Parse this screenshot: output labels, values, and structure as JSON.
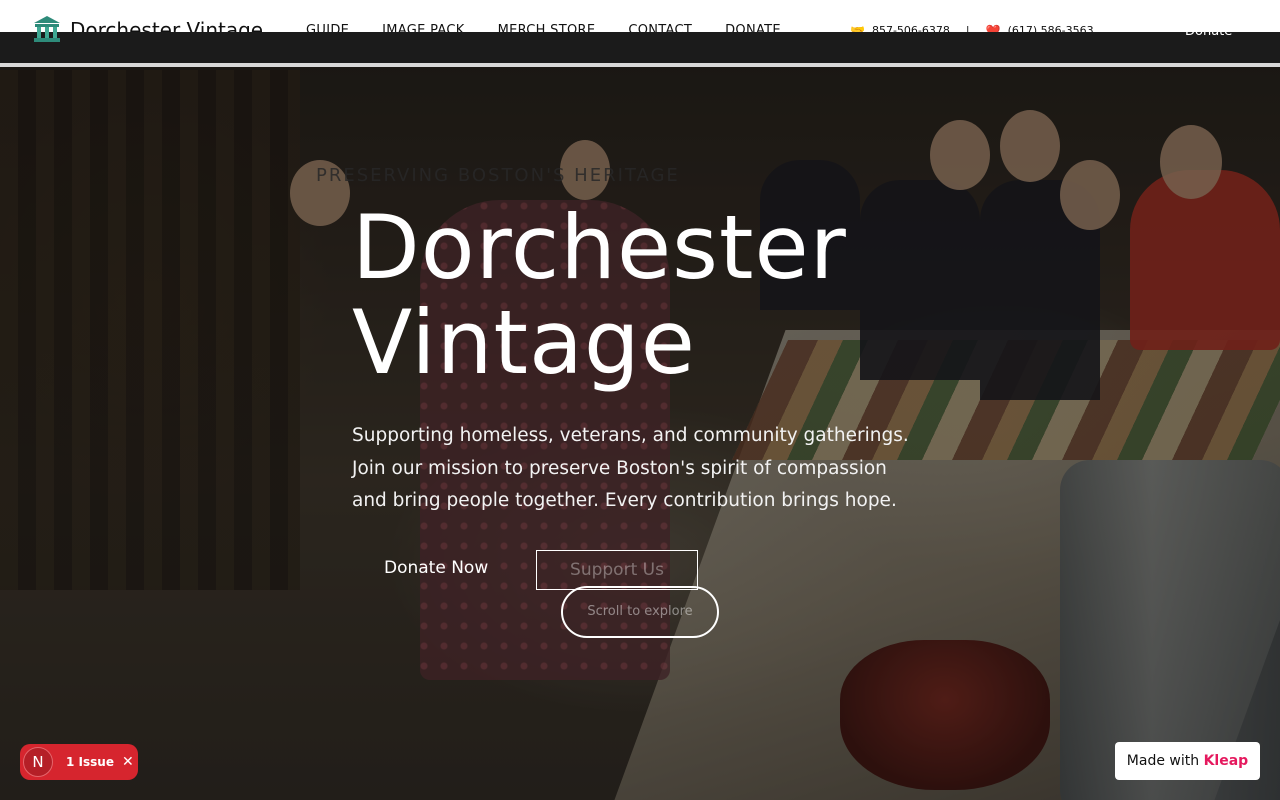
{
  "header": {
    "brand": "Dorchester Vintage",
    "nav": [
      "GUIDE",
      "IMAGE PACK",
      "MERCH STORE",
      "CONTACT",
      "DONATE"
    ],
    "phone1": "857-506-6378",
    "phone2": "(617) 586-3563",
    "separator": "|",
    "donate_label": "Donate",
    "icons": {
      "logo": "museum-building-icon",
      "phone1": "handshake-icon",
      "phone2": "heart-icon"
    }
  },
  "hero": {
    "eyebrow": "PRESERVING BOSTON'S HERITAGE",
    "title_line1": "Dorchester",
    "title_line2": "Vintage",
    "subtitle": "Supporting homeless, veterans, and community gatherings. Join our mission to preserve Boston's spirit of compassion and bring people together. Every contribution brings hope.",
    "donate_button": "Donate Now",
    "support_button": "Support Us",
    "scroll_button": "Scroll to explore"
  },
  "widgets": {
    "issue_badge_letter": "N",
    "issue_text": "1 Issue",
    "close_glyph": "✕",
    "made_with_prefix": "Made with",
    "made_with_brand": "Kleap"
  },
  "colors": {
    "issue_red": "#d6252e",
    "kleap_pink": "#e5195e",
    "header_bg": "#ffffff"
  }
}
